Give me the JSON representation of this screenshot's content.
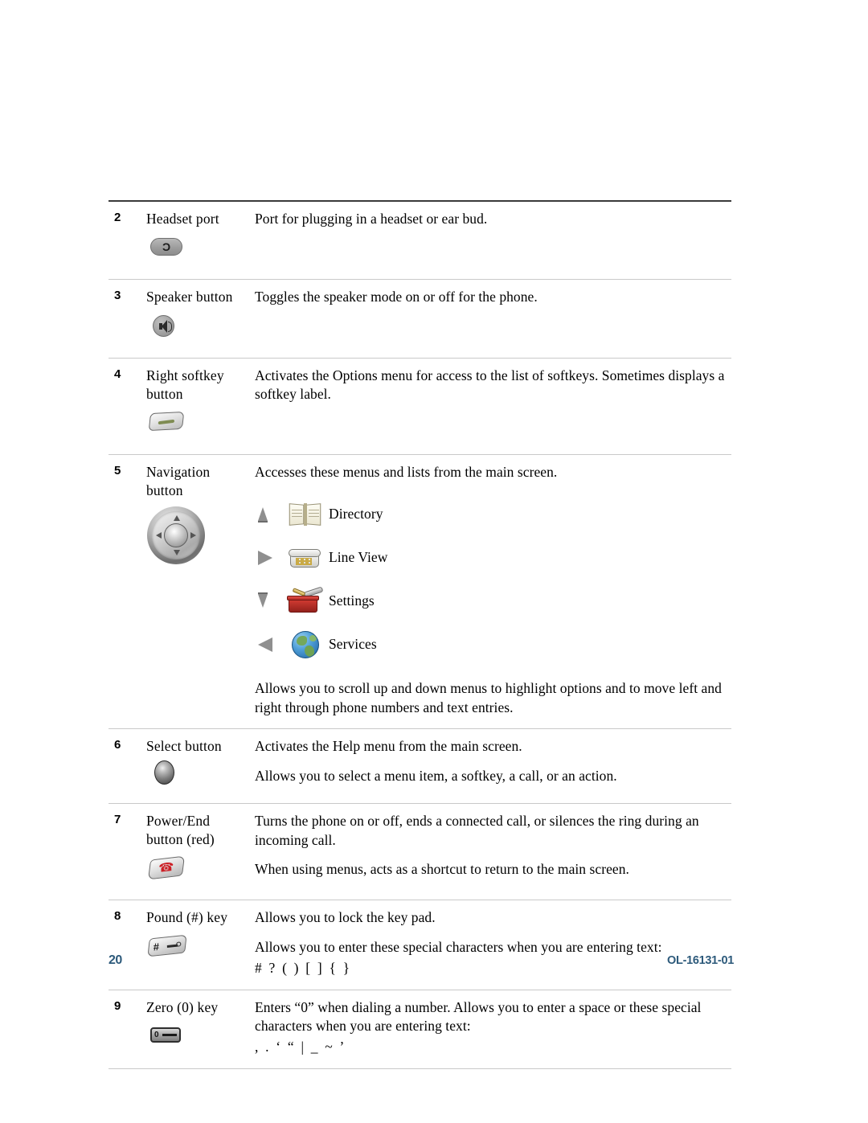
{
  "document": {
    "page_number": "20",
    "document_id": "OL-16131-01"
  },
  "table": {
    "rows": [
      {
        "number": "2",
        "name": "Headset port",
        "icon": "headset-port-icon",
        "paragraphs": [
          "Port for plugging in a headset or ear bud."
        ]
      },
      {
        "number": "3",
        "name": "Speaker button",
        "icon": "speaker-button-icon",
        "paragraphs": [
          "Toggles the speaker mode on or off for the phone."
        ]
      },
      {
        "number": "4",
        "name": "Right softkey button",
        "icon": "right-softkey-icon",
        "paragraphs": [
          "Activates the Options menu for access to the list of softkeys. Sometimes displays a softkey label."
        ]
      },
      {
        "number": "5",
        "name": "Navigation button",
        "icon": "navigation-button-icon",
        "paragraphs": [
          "Accesses these menus and lists from the main screen."
        ],
        "menu_items": [
          {
            "arrow": "up-arrow-icon",
            "icon": "directory-book-icon",
            "label": "Directory"
          },
          {
            "arrow": "right-arrow-icon",
            "icon": "line-view-phone-icon",
            "label": "Line View"
          },
          {
            "arrow": "down-arrow-icon",
            "icon": "settings-toolbox-icon",
            "label": "Settings"
          },
          {
            "arrow": "left-arrow-icon",
            "icon": "services-globe-icon",
            "label": "Services"
          }
        ],
        "trailing_paragraphs": [
          "Allows you to scroll up and down menus to highlight options and to move left and right through phone numbers and text entries."
        ]
      },
      {
        "number": "6",
        "name": "Select button",
        "icon": "select-button-icon",
        "paragraphs": [
          "Activates the Help menu from the main screen.",
          "Allows you to select a menu item, a softkey, a call, or an action."
        ]
      },
      {
        "number": "7",
        "name": "Power/End button (red)",
        "icon": "power-end-button-icon",
        "paragraphs": [
          "Turns the phone on or off, ends a connected call, or silences the ring during an incoming call.",
          "When using menus, acts as a shortcut to return to the main screen."
        ]
      },
      {
        "number": "8",
        "name": "Pound (#) key",
        "icon": "pound-key-icon",
        "paragraphs": [
          "Allows you to lock the key pad.",
          "Allows you to enter these special characters when you are entering text:"
        ],
        "special_characters": "# ? ( ) [ ] { }"
      },
      {
        "number": "9",
        "name": "Zero (0) key",
        "icon": "zero-key-icon",
        "paragraphs": [
          "Enters “0” when dialing a number. Allows you to enter a space or these special characters when you are entering text:"
        ],
        "special_characters": ", . ‘ “ | _ ~ ’"
      }
    ]
  },
  "colors": {
    "footer_blue": "#2d5a7b",
    "rule_dark": "#3a3a3a",
    "rule_light": "#c9c9c9"
  }
}
